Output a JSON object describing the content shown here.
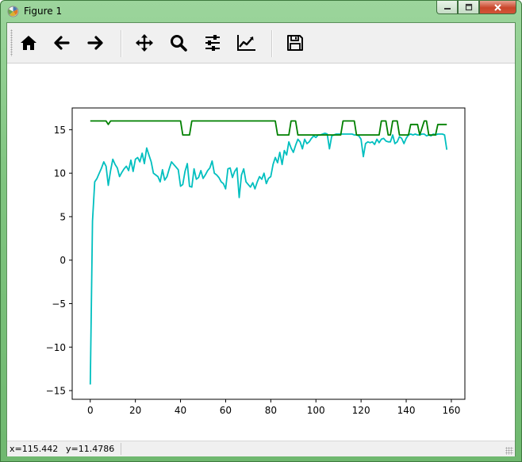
{
  "window": {
    "title": "Figure 1"
  },
  "toolbar": {
    "buttons": [
      {
        "icon": "home-icon"
      },
      {
        "icon": "back-arrow-icon"
      },
      {
        "icon": "forward-arrow-icon"
      },
      {
        "icon": "pan-move-icon"
      },
      {
        "icon": "zoom-magnifier-icon"
      },
      {
        "icon": "configure-subplots-icon"
      },
      {
        "icon": "edit-axis-icon"
      },
      {
        "icon": "save-floppy-icon"
      }
    ]
  },
  "status": {
    "x_readout": "x=115.442",
    "y_readout": "y=11.4786"
  },
  "chart_data": {
    "type": "line",
    "title": "",
    "xlabel": "",
    "ylabel": "",
    "xlim": [
      -8,
      166
    ],
    "ylim": [
      -16,
      17.5
    ],
    "xticks": [
      0,
      20,
      40,
      60,
      80,
      100,
      120,
      140,
      160
    ],
    "yticks": [
      -15,
      -10,
      -5,
      0,
      5,
      10,
      15
    ],
    "xtick_labels": [
      "0",
      "20",
      "40",
      "60",
      "80",
      "100",
      "120",
      "140",
      "160"
    ],
    "ytick_labels": [
      "−15",
      "−10",
      "−5",
      "0",
      "5",
      "10",
      "15"
    ],
    "grid": false,
    "series": [
      {
        "color": "#00bfbf",
        "x": [
          0,
          1,
          2,
          3,
          4,
          5,
          6,
          7,
          8,
          9,
          10,
          11,
          12,
          13,
          14,
          15,
          16,
          17,
          18,
          19,
          20,
          21,
          22,
          23,
          24,
          25,
          26,
          27,
          28,
          29,
          30,
          31,
          32,
          33,
          34,
          35,
          36,
          37,
          38,
          39,
          40,
          41,
          42,
          43,
          44,
          45,
          46,
          47,
          48,
          49,
          50,
          51,
          52,
          53,
          54,
          55,
          56,
          57,
          58,
          59,
          60,
          61,
          62,
          63,
          64,
          65,
          66,
          67,
          68,
          69,
          70,
          71,
          72,
          73,
          74,
          75,
          76,
          77,
          78,
          79,
          80,
          81,
          82,
          83,
          84,
          85,
          86,
          87,
          88,
          89,
          90,
          91,
          92,
          93,
          94,
          95,
          96,
          97,
          98,
          99,
          100,
          101,
          102,
          103,
          104,
          105,
          106,
          107,
          108,
          109,
          110,
          111,
          112,
          113,
          114,
          115,
          116,
          117,
          118,
          119,
          120,
          121,
          122,
          123,
          124,
          125,
          126,
          127,
          128,
          129,
          130,
          131,
          132,
          133,
          134,
          135,
          136,
          137,
          138,
          139,
          140,
          141,
          142,
          143,
          144,
          145,
          146,
          147,
          148,
          149,
          150,
          151,
          152,
          153,
          154,
          155,
          156,
          157,
          158
        ],
        "y": [
          -14.3,
          4.5,
          9.0,
          9.4,
          10.0,
          10.6,
          11.3,
          10.8,
          8.6,
          10.3,
          11.6,
          11.0,
          10.6,
          9.6,
          10.1,
          10.5,
          10.8,
          10.3,
          11.5,
          10.2,
          11.6,
          11.8,
          11.3,
          12.3,
          11.1,
          12.9,
          12.1,
          11.3,
          10.0,
          9.8,
          9.6,
          9.0,
          10.4,
          9.2,
          9.6,
          10.5,
          11.3,
          11.0,
          10.7,
          10.4,
          8.5,
          8.7,
          10.2,
          11.1,
          8.5,
          8.4,
          10.5,
          9.3,
          9.5,
          10.3,
          9.4,
          9.8,
          10.3,
          10.6,
          11.4,
          10.0,
          9.8,
          9.5,
          9.0,
          8.8,
          8.2,
          10.5,
          10.6,
          9.5,
          10.2,
          10.6,
          7.2,
          9.8,
          10.5,
          9.0,
          8.7,
          8.4,
          8.9,
          8.2,
          9.0,
          9.6,
          9.3,
          10.0,
          8.8,
          9.4,
          9.6,
          11.0,
          11.8,
          11.2,
          12.4,
          11.0,
          12.6,
          12.1,
          13.6,
          12.9,
          12.4,
          13.2,
          13.9,
          13.6,
          12.8,
          13.9,
          13.4,
          13.6,
          14.0,
          14.3,
          14.1,
          14.4,
          14.4,
          14.5,
          14.6,
          14.5,
          12.8,
          14.3,
          14.4,
          14.5,
          14.5,
          14.5,
          14.5,
          14.5,
          14.5,
          14.5,
          14.5,
          14.4,
          14.4,
          14.3,
          13.9,
          11.9,
          13.4,
          13.6,
          13.5,
          13.6,
          13.3,
          13.9,
          13.5,
          13.9,
          14.0,
          13.7,
          13.6,
          13.6,
          14.4,
          13.4,
          13.6,
          14.2,
          14.0,
          13.4,
          14.0,
          14.4,
          14.5,
          14.4,
          14.5,
          14.4,
          14.4,
          14.5,
          14.5,
          14.3,
          14.4,
          14.3,
          14.5,
          14.4,
          14.5,
          14.5,
          14.5,
          14.4,
          12.7
        ]
      },
      {
        "color": "#008000",
        "x": [
          0,
          7,
          8,
          9,
          40,
          41,
          44,
          45,
          82,
          83,
          88,
          89,
          91,
          92,
          93,
          111,
          112,
          117,
          118,
          128,
          129,
          131,
          132,
          133,
          134,
          136,
          137,
          138,
          141,
          142,
          145,
          146,
          148,
          149,
          150,
          153,
          154,
          158
        ],
        "y": [
          16.0,
          16.0,
          15.6,
          16.0,
          16.0,
          14.4,
          14.4,
          16.0,
          16.0,
          14.4,
          14.4,
          16.0,
          16.0,
          14.4,
          14.4,
          14.4,
          16.0,
          16.0,
          14.4,
          14.4,
          16.0,
          16.0,
          14.4,
          14.4,
          16.0,
          16.0,
          14.4,
          14.4,
          14.4,
          15.6,
          15.6,
          14.4,
          16.0,
          16.0,
          14.4,
          14.4,
          15.6,
          15.6
        ]
      }
    ]
  }
}
